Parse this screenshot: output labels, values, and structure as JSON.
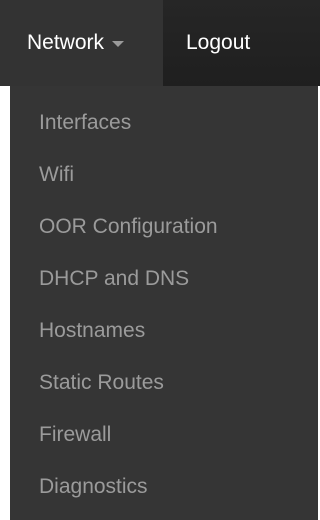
{
  "navbar": {
    "network_label": "Network",
    "logout_label": "Logout"
  },
  "menu": {
    "items": [
      {
        "label": "Interfaces"
      },
      {
        "label": "Wifi"
      },
      {
        "label": "OOR Configuration"
      },
      {
        "label": "DHCP and DNS"
      },
      {
        "label": "Hostnames"
      },
      {
        "label": "Static Routes"
      },
      {
        "label": "Firewall"
      },
      {
        "label": "Diagnostics"
      }
    ]
  },
  "icons": {
    "dropdown": "caret-down-icon"
  },
  "colors": {
    "navbar_bg": "#222222",
    "active_tab_bg": "#333333",
    "menu_bg": "#353535",
    "menu_text": "#9b9b9b",
    "nav_text": "#ffffff"
  }
}
